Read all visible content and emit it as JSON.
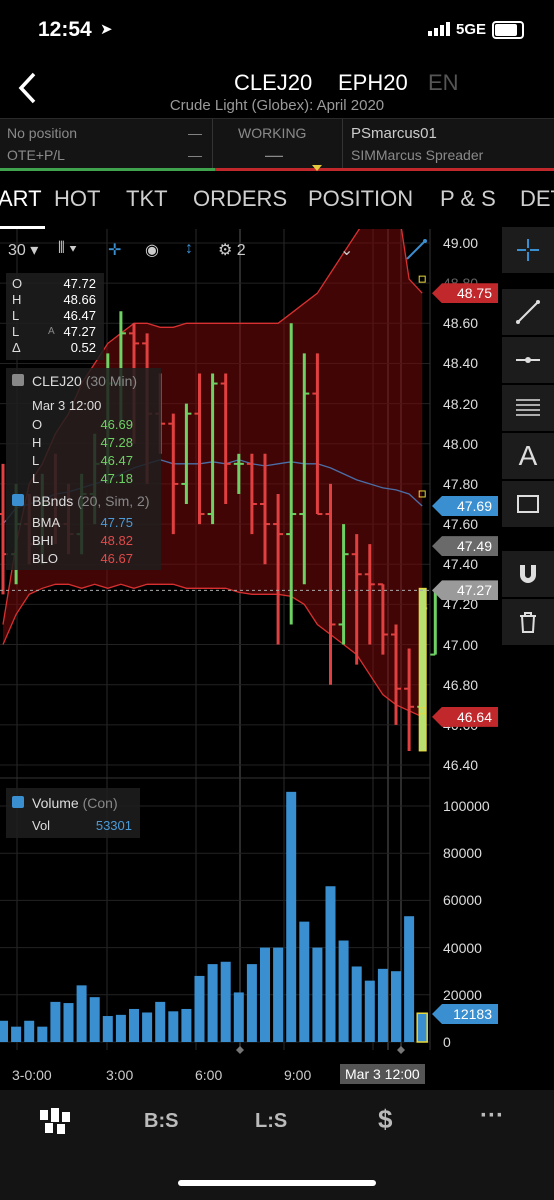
{
  "status_bar": {
    "time": "12:54",
    "network": "5GE"
  },
  "header": {
    "symbols": [
      "CLEJ20",
      "EPH20",
      "EN"
    ],
    "subtitle": "Crude Light (Globex): April 2020"
  },
  "info_row": {
    "position_label": "No position",
    "pnl_label": "OTE+P/L",
    "position_value": "—",
    "pnl_value": "—",
    "working_label": "WORKING",
    "working_value": "—",
    "account": "PSmarcus01",
    "account_name": "SIMMarcus Spreader"
  },
  "tabs": [
    "ART",
    "HOT",
    "TKT",
    "ORDERS",
    "POSITION",
    "P & S",
    "DET"
  ],
  "chart_toolbar": {
    "interval": "30",
    "layers_count": "2"
  },
  "ohlc_panel": {
    "labels": [
      "O",
      "H",
      "L",
      "L",
      "Δ"
    ],
    "values": [
      "47.72",
      "48.66",
      "46.47",
      "47.27",
      "0.52"
    ],
    "last_marker": "A"
  },
  "study_panel": {
    "title": "CLEJ20",
    "title_suffix": "(30 Min)",
    "date": "Mar 3 12:00",
    "labels": [
      "O",
      "H",
      "L",
      "L"
    ],
    "values": [
      "46.69",
      "47.28",
      "46.47",
      "47.18"
    ],
    "bb_title": "BBnds",
    "bb_suffix": "(20, Sim, 2)",
    "bb_labels": [
      "BMA",
      "BHI",
      "BLO"
    ],
    "bb_values": [
      "47.75",
      "48.82",
      "46.67"
    ]
  },
  "volume_panel": {
    "title": "Volume",
    "title_suffix": "(Con)",
    "label": "Vol",
    "value": "53301"
  },
  "price_axis": [
    "49.00",
    "48.80",
    "48.60",
    "48.40",
    "48.20",
    "48.00",
    "47.80",
    "47.60",
    "47.40",
    "47.20",
    "47.00",
    "46.80",
    "46.60",
    "46.40"
  ],
  "price_tags": [
    {
      "value": "48.75",
      "color": "#c0282b"
    },
    {
      "value": "47.69",
      "color": "#3a8fd0"
    },
    {
      "value": "47.49",
      "color": "#6a6a6a"
    },
    {
      "value": "47.27",
      "color": "#9a9a9a"
    },
    {
      "value": "46.64",
      "color": "#c0282b"
    }
  ],
  "volume_axis": [
    "100000",
    "80000",
    "60000",
    "40000",
    "20000",
    "0"
  ],
  "volume_tag": "12183",
  "time_axis": [
    "3-0:00",
    "3:00",
    "6:00",
    "9:00",
    "Mar 3 12:00"
  ],
  "bottom_nav": [
    "B:S",
    "L:S",
    "$",
    "···"
  ],
  "chart_data": {
    "type": "bar",
    "series": [
      {
        "o": 47.65,
        "h": 47.9,
        "l": 47.25,
        "c": 47.45
      },
      {
        "o": 47.45,
        "h": 47.8,
        "l": 47.3,
        "c": 47.6
      },
      {
        "o": 47.6,
        "h": 47.75,
        "l": 47.4,
        "c": 47.5
      },
      {
        "o": 47.5,
        "h": 47.85,
        "l": 47.4,
        "c": 47.7
      },
      {
        "o": 47.7,
        "h": 47.95,
        "l": 47.5,
        "c": 47.6
      },
      {
        "o": 47.6,
        "h": 47.8,
        "l": 47.45,
        "c": 47.55
      },
      {
        "o": 47.55,
        "h": 47.85,
        "l": 47.45,
        "c": 47.75
      },
      {
        "o": 47.75,
        "h": 48.05,
        "l": 47.6,
        "c": 47.9
      },
      {
        "o": 47.9,
        "h": 48.45,
        "l": 47.8,
        "c": 48.3
      },
      {
        "o": 48.3,
        "h": 48.66,
        "l": 48.1,
        "c": 48.55
      },
      {
        "o": 48.55,
        "h": 48.6,
        "l": 48.0,
        "c": 48.5
      },
      {
        "o": 48.5,
        "h": 48.55,
        "l": 47.8,
        "c": 48.15
      },
      {
        "o": 48.15,
        "h": 48.35,
        "l": 47.95,
        "c": 48.1
      },
      {
        "o": 48.1,
        "h": 48.15,
        "l": 47.55,
        "c": 47.8
      },
      {
        "o": 47.8,
        "h": 48.2,
        "l": 47.7,
        "c": 48.15
      },
      {
        "o": 48.15,
        "h": 48.35,
        "l": 47.6,
        "c": 47.65
      },
      {
        "o": 47.65,
        "h": 48.35,
        "l": 47.6,
        "c": 48.3
      },
      {
        "o": 48.3,
        "h": 48.35,
        "l": 47.7,
        "c": 47.9
      },
      {
        "o": 47.9,
        "h": 47.95,
        "l": 47.75,
        "c": 47.9
      },
      {
        "o": 47.9,
        "h": 47.95,
        "l": 47.55,
        "c": 47.7
      },
      {
        "o": 47.7,
        "h": 47.95,
        "l": 47.4,
        "c": 47.6
      },
      {
        "o": 47.6,
        "h": 47.75,
        "l": 47.0,
        "c": 47.55
      },
      {
        "o": 47.55,
        "h": 48.6,
        "l": 47.1,
        "c": 47.65
      },
      {
        "o": 47.65,
        "h": 48.45,
        "l": 47.3,
        "c": 48.25
      },
      {
        "o": 48.25,
        "h": 48.45,
        "l": 47.65,
        "c": 47.65
      },
      {
        "o": 47.65,
        "h": 47.8,
        "l": 46.8,
        "c": 47.1
      },
      {
        "o": 47.1,
        "h": 47.6,
        "l": 47.0,
        "c": 47.45
      },
      {
        "o": 47.45,
        "h": 47.55,
        "l": 46.9,
        "c": 47.35
      },
      {
        "o": 47.35,
        "h": 47.5,
        "l": 47.0,
        "c": 47.3
      },
      {
        "o": 47.3,
        "h": 47.3,
        "l": 46.95,
        "c": 47.05
      },
      {
        "o": 47.05,
        "h": 47.1,
        "l": 46.6,
        "c": 46.78
      },
      {
        "o": 46.78,
        "h": 46.98,
        "l": 46.47,
        "c": 46.69
      },
      {
        "o": 46.69,
        "h": 47.28,
        "l": 46.47,
        "c": 47.18
      },
      {
        "o": 46.95,
        "h": 47.27,
        "l": 46.95,
        "c": 47.27
      }
    ],
    "volume": [
      9000,
      6500,
      9000,
      6500,
      17000,
      16500,
      24000,
      19000,
      11000,
      11500,
      14000,
      12500,
      17000,
      13000,
      14000,
      28000,
      33000,
      34000,
      21000,
      33000,
      40000,
      40000,
      106000,
      51000,
      40000,
      66000,
      43000,
      32000,
      26000,
      31000,
      30000,
      53301,
      12183
    ],
    "bollinger": {
      "bhi": 48.82,
      "bma": 47.75,
      "blo": 46.67
    },
    "y_range": [
      46.2,
      49.05
    ],
    "volume_range": [
      0,
      110000
    ],
    "ylabel": "",
    "xlabel": ""
  }
}
